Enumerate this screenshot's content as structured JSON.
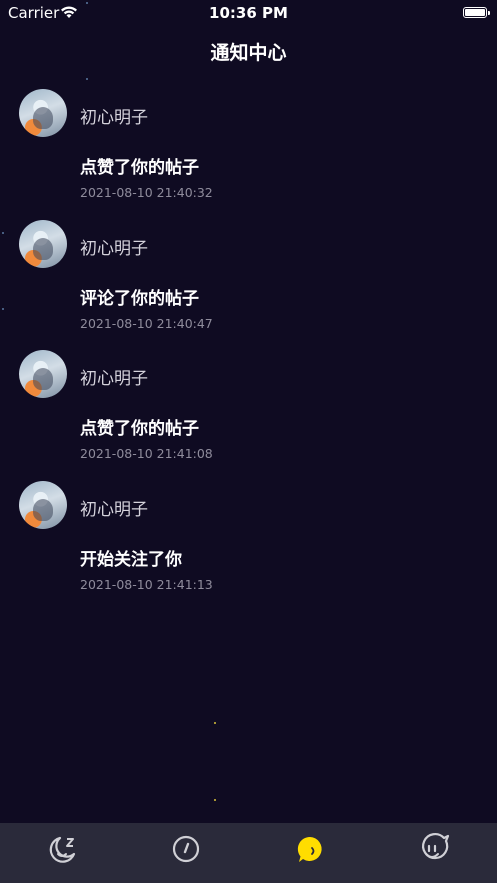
{
  "status_bar": {
    "carrier": "Carrier",
    "time": "10:36 PM"
  },
  "nav": {
    "title": "通知中心"
  },
  "notifications": [
    {
      "username": "初心明子",
      "action": "点赞了你的帖子",
      "time": "2021-08-10 21:40:32"
    },
    {
      "username": "初心明子",
      "action": "评论了你的帖子",
      "time": "2021-08-10 21:40:47"
    },
    {
      "username": "初心明子",
      "action": "点赞了你的帖子",
      "time": "2021-08-10 21:41:08"
    },
    {
      "username": "初心明子",
      "action": "开始关注了你",
      "time": "2021-08-10 21:41:13"
    }
  ],
  "tab_bar": {
    "tabs": [
      {
        "icon": "moon-sleep-icon",
        "active": false
      },
      {
        "icon": "compass-icon",
        "active": false
      },
      {
        "icon": "chat-bubble-icon",
        "active": true
      },
      {
        "icon": "face-bubble-icon",
        "active": false
      }
    ],
    "active_color": "#ffdd00",
    "inactive_color": "#d0d0d6"
  },
  "colors": {
    "background": "#0f0b22",
    "tab_bar": "#2a2a3a"
  }
}
